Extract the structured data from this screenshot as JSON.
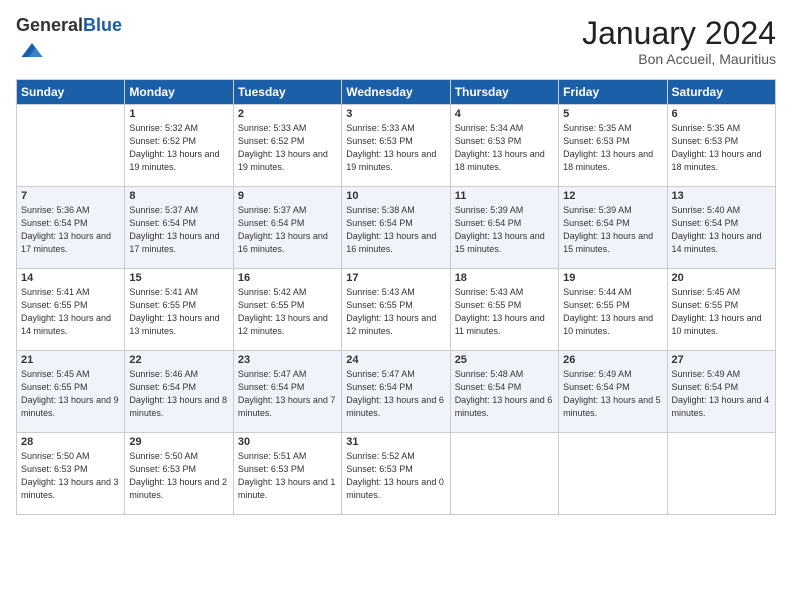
{
  "header": {
    "logo_general": "General",
    "logo_blue": "Blue",
    "month_title": "January 2024",
    "location": "Bon Accueil, Mauritius"
  },
  "days_of_week": [
    "Sunday",
    "Monday",
    "Tuesday",
    "Wednesday",
    "Thursday",
    "Friday",
    "Saturday"
  ],
  "weeks": [
    [
      {
        "day": "",
        "sunrise": "",
        "sunset": "",
        "daylight": ""
      },
      {
        "day": "1",
        "sunrise": "Sunrise: 5:32 AM",
        "sunset": "Sunset: 6:52 PM",
        "daylight": "Daylight: 13 hours and 19 minutes."
      },
      {
        "day": "2",
        "sunrise": "Sunrise: 5:33 AM",
        "sunset": "Sunset: 6:52 PM",
        "daylight": "Daylight: 13 hours and 19 minutes."
      },
      {
        "day": "3",
        "sunrise": "Sunrise: 5:33 AM",
        "sunset": "Sunset: 6:53 PM",
        "daylight": "Daylight: 13 hours and 19 minutes."
      },
      {
        "day": "4",
        "sunrise": "Sunrise: 5:34 AM",
        "sunset": "Sunset: 6:53 PM",
        "daylight": "Daylight: 13 hours and 18 minutes."
      },
      {
        "day": "5",
        "sunrise": "Sunrise: 5:35 AM",
        "sunset": "Sunset: 6:53 PM",
        "daylight": "Daylight: 13 hours and 18 minutes."
      },
      {
        "day": "6",
        "sunrise": "Sunrise: 5:35 AM",
        "sunset": "Sunset: 6:53 PM",
        "daylight": "Daylight: 13 hours and 18 minutes."
      }
    ],
    [
      {
        "day": "7",
        "sunrise": "Sunrise: 5:36 AM",
        "sunset": "Sunset: 6:54 PM",
        "daylight": "Daylight: 13 hours and 17 minutes."
      },
      {
        "day": "8",
        "sunrise": "Sunrise: 5:37 AM",
        "sunset": "Sunset: 6:54 PM",
        "daylight": "Daylight: 13 hours and 17 minutes."
      },
      {
        "day": "9",
        "sunrise": "Sunrise: 5:37 AM",
        "sunset": "Sunset: 6:54 PM",
        "daylight": "Daylight: 13 hours and 16 minutes."
      },
      {
        "day": "10",
        "sunrise": "Sunrise: 5:38 AM",
        "sunset": "Sunset: 6:54 PM",
        "daylight": "Daylight: 13 hours and 16 minutes."
      },
      {
        "day": "11",
        "sunrise": "Sunrise: 5:39 AM",
        "sunset": "Sunset: 6:54 PM",
        "daylight": "Daylight: 13 hours and 15 minutes."
      },
      {
        "day": "12",
        "sunrise": "Sunrise: 5:39 AM",
        "sunset": "Sunset: 6:54 PM",
        "daylight": "Daylight: 13 hours and 15 minutes."
      },
      {
        "day": "13",
        "sunrise": "Sunrise: 5:40 AM",
        "sunset": "Sunset: 6:54 PM",
        "daylight": "Daylight: 13 hours and 14 minutes."
      }
    ],
    [
      {
        "day": "14",
        "sunrise": "Sunrise: 5:41 AM",
        "sunset": "Sunset: 6:55 PM",
        "daylight": "Daylight: 13 hours and 14 minutes."
      },
      {
        "day": "15",
        "sunrise": "Sunrise: 5:41 AM",
        "sunset": "Sunset: 6:55 PM",
        "daylight": "Daylight: 13 hours and 13 minutes."
      },
      {
        "day": "16",
        "sunrise": "Sunrise: 5:42 AM",
        "sunset": "Sunset: 6:55 PM",
        "daylight": "Daylight: 13 hours and 12 minutes."
      },
      {
        "day": "17",
        "sunrise": "Sunrise: 5:43 AM",
        "sunset": "Sunset: 6:55 PM",
        "daylight": "Daylight: 13 hours and 12 minutes."
      },
      {
        "day": "18",
        "sunrise": "Sunrise: 5:43 AM",
        "sunset": "Sunset: 6:55 PM",
        "daylight": "Daylight: 13 hours and 11 minutes."
      },
      {
        "day": "19",
        "sunrise": "Sunrise: 5:44 AM",
        "sunset": "Sunset: 6:55 PM",
        "daylight": "Daylight: 13 hours and 10 minutes."
      },
      {
        "day": "20",
        "sunrise": "Sunrise: 5:45 AM",
        "sunset": "Sunset: 6:55 PM",
        "daylight": "Daylight: 13 hours and 10 minutes."
      }
    ],
    [
      {
        "day": "21",
        "sunrise": "Sunrise: 5:45 AM",
        "sunset": "Sunset: 6:55 PM",
        "daylight": "Daylight: 13 hours and 9 minutes."
      },
      {
        "day": "22",
        "sunrise": "Sunrise: 5:46 AM",
        "sunset": "Sunset: 6:54 PM",
        "daylight": "Daylight: 13 hours and 8 minutes."
      },
      {
        "day": "23",
        "sunrise": "Sunrise: 5:47 AM",
        "sunset": "Sunset: 6:54 PM",
        "daylight": "Daylight: 13 hours and 7 minutes."
      },
      {
        "day": "24",
        "sunrise": "Sunrise: 5:47 AM",
        "sunset": "Sunset: 6:54 PM",
        "daylight": "Daylight: 13 hours and 6 minutes."
      },
      {
        "day": "25",
        "sunrise": "Sunrise: 5:48 AM",
        "sunset": "Sunset: 6:54 PM",
        "daylight": "Daylight: 13 hours and 6 minutes."
      },
      {
        "day": "26",
        "sunrise": "Sunrise: 5:49 AM",
        "sunset": "Sunset: 6:54 PM",
        "daylight": "Daylight: 13 hours and 5 minutes."
      },
      {
        "day": "27",
        "sunrise": "Sunrise: 5:49 AM",
        "sunset": "Sunset: 6:54 PM",
        "daylight": "Daylight: 13 hours and 4 minutes."
      }
    ],
    [
      {
        "day": "28",
        "sunrise": "Sunrise: 5:50 AM",
        "sunset": "Sunset: 6:53 PM",
        "daylight": "Daylight: 13 hours and 3 minutes."
      },
      {
        "day": "29",
        "sunrise": "Sunrise: 5:50 AM",
        "sunset": "Sunset: 6:53 PM",
        "daylight": "Daylight: 13 hours and 2 minutes."
      },
      {
        "day": "30",
        "sunrise": "Sunrise: 5:51 AM",
        "sunset": "Sunset: 6:53 PM",
        "daylight": "Daylight: 13 hours and 1 minute."
      },
      {
        "day": "31",
        "sunrise": "Sunrise: 5:52 AM",
        "sunset": "Sunset: 6:53 PM",
        "daylight": "Daylight: 13 hours and 0 minutes."
      },
      {
        "day": "",
        "sunrise": "",
        "sunset": "",
        "daylight": ""
      },
      {
        "day": "",
        "sunrise": "",
        "sunset": "",
        "daylight": ""
      },
      {
        "day": "",
        "sunrise": "",
        "sunset": "",
        "daylight": ""
      }
    ]
  ]
}
